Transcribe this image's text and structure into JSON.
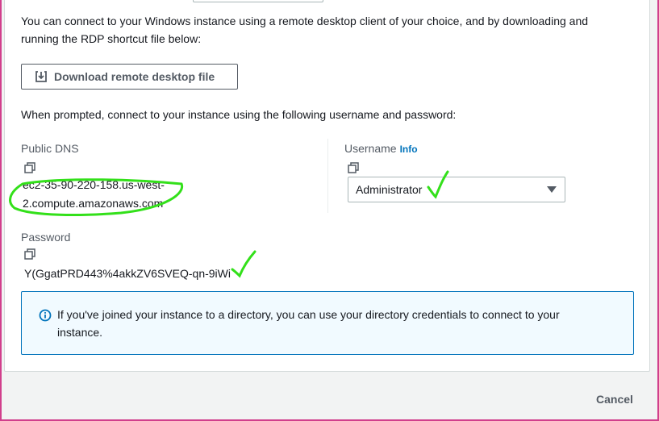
{
  "intro": {
    "text": "You can connect to your Windows instance using a remote desktop client of your choice, and by downloading and running the RDP shortcut file below:"
  },
  "download_button": {
    "label": "Download remote desktop file"
  },
  "prompt": "When prompted, connect to your instance using the following username and password:",
  "public_dns": {
    "label": "Public DNS",
    "value_line1": "ec2-35-90-220-158.us-west-",
    "value_line2": "2.compute.amazonaws.com"
  },
  "username": {
    "label": "Username",
    "info_link": "Info",
    "selected": "Administrator"
  },
  "password": {
    "label": "Password",
    "value": "Y(GgatPRD443%4akkZV6SVEQ-qn-9iWi"
  },
  "alert": {
    "text": "If you've joined your instance to a directory, you can use your directory credentials to connect to your instance."
  },
  "footer": {
    "cancel_label": "Cancel"
  },
  "colors": {
    "annotation": "#33e01a",
    "link": "#0073bb",
    "alert_border": "#0073bb",
    "alert_bg": "#f1faff",
    "frame": "#d13f8c"
  },
  "icons": [
    "download-icon",
    "copy-icon",
    "caret-down-icon",
    "info-circle-icon"
  ]
}
